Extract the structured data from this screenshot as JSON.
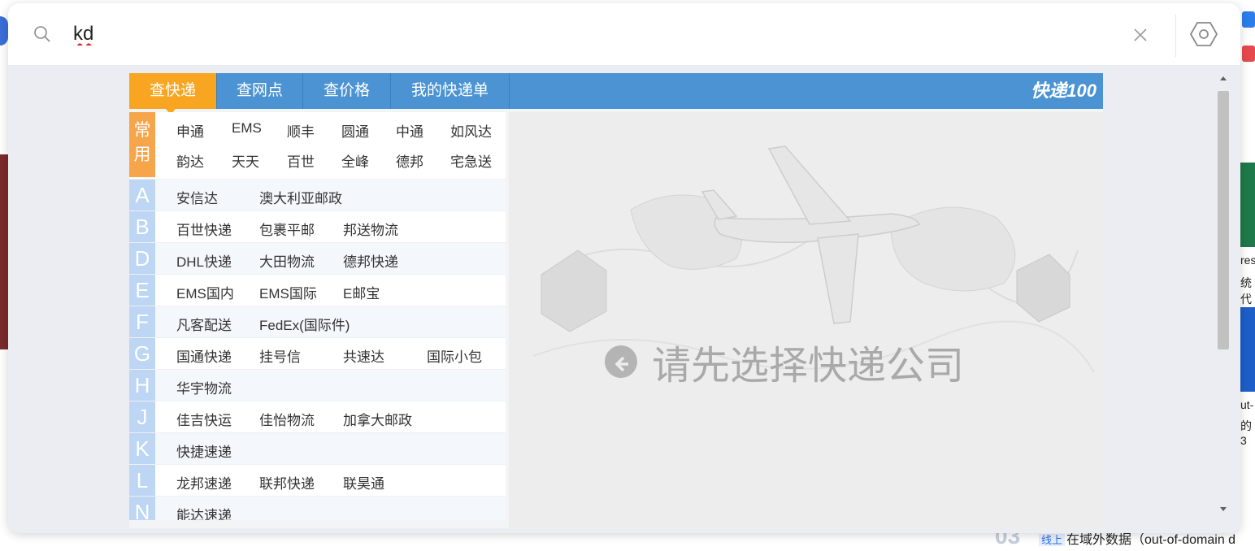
{
  "search": {
    "value": "kd"
  },
  "tabs": [
    {
      "label": "查快递",
      "active": true
    },
    {
      "label": "查网点",
      "active": false
    },
    {
      "label": "查价格",
      "active": false
    },
    {
      "label": "我的快递单",
      "active": false
    }
  ],
  "logo": "快递100",
  "common": {
    "letter_a": "常",
    "letter_b": "用",
    "row1": [
      "申通",
      "EMS",
      "顺丰",
      "圆通",
      "中通",
      "如风达"
    ],
    "row2": [
      "韵达",
      "天天",
      "百世",
      "全峰",
      "德邦",
      "宅急送"
    ]
  },
  "groups": [
    {
      "letter": "A",
      "items": [
        "安信达",
        "澳大利亚邮政"
      ]
    },
    {
      "letter": "B",
      "items": [
        "百世快递",
        "包裹平邮",
        "邦送物流"
      ]
    },
    {
      "letter": "D",
      "items": [
        "DHL快递",
        "大田物流",
        "德邦快递"
      ]
    },
    {
      "letter": "E",
      "items": [
        "EMS国内",
        "EMS国际",
        "E邮宝"
      ]
    },
    {
      "letter": "F",
      "items": [
        "凡客配送",
        "FedEx(国际件)"
      ]
    },
    {
      "letter": "G",
      "items": [
        "国通快递",
        "挂号信",
        "共速达",
        "国际小包"
      ]
    },
    {
      "letter": "H",
      "items": [
        "华宇物流"
      ]
    },
    {
      "letter": "J",
      "items": [
        "佳吉快运",
        "佳怡物流",
        "加拿大邮政"
      ]
    },
    {
      "letter": "K",
      "items": [
        "快捷速递"
      ]
    },
    {
      "letter": "L",
      "items": [
        "龙邦速递",
        "联邦快递",
        "联昊通"
      ]
    },
    {
      "letter": "N",
      "items": [
        "能达速递"
      ]
    }
  ],
  "panel": {
    "prompt": "请先选择快递公司"
  },
  "background": {
    "right_text": [
      "res",
      "统代",
      "ut-",
      "的3"
    ],
    "bottom": {
      "num": "03",
      "tag": "线上",
      "text": "在域外数据（out-of-domain d"
    }
  },
  "colors": {
    "tab_bar": "#4b93d3",
    "tab_active": "#f8a522",
    "common_letter": "#f7a54a",
    "group_letter": "#bcd6f4"
  }
}
